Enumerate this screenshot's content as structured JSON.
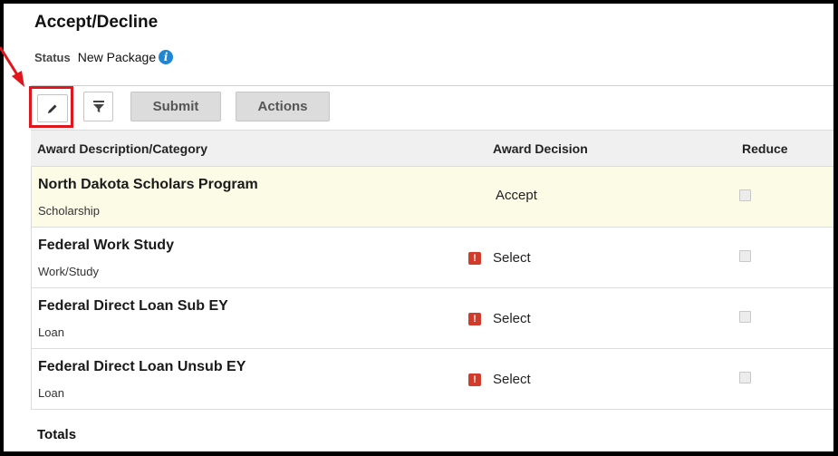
{
  "header": {
    "title": "Accept/Decline",
    "status_label": "Status",
    "status_value": "New Package",
    "info_icon": "i"
  },
  "toolbar": {
    "edit_icon": "pencil-icon",
    "filter_icon": "filter-icon",
    "submit_label": "Submit",
    "actions_label": "Actions"
  },
  "table": {
    "columns": [
      "Award Description/Category",
      "Award Decision",
      "Reduce"
    ],
    "rows": [
      {
        "name": "North Dakota Scholars Program",
        "category": "Scholarship",
        "decision": "Accept",
        "warning": false,
        "reduce": false
      },
      {
        "name": "Federal Work Study",
        "category": "Work/Study",
        "decision": "Select",
        "warning": true,
        "reduce": false
      },
      {
        "name": "Federal Direct Loan Sub EY",
        "category": "Loan",
        "decision": "Select",
        "warning": true,
        "reduce": false
      },
      {
        "name": "Federal Direct Loan Unsub EY",
        "category": "Loan",
        "decision": "Select",
        "warning": true,
        "reduce": false
      }
    ],
    "warning_glyph": "!",
    "totals_label": "Totals"
  },
  "colors": {
    "highlight_box": "#e0161c",
    "info_icon": "#1f86d4",
    "warning_icon": "#d13b2a",
    "highlight_row": "#fcfbe6"
  }
}
